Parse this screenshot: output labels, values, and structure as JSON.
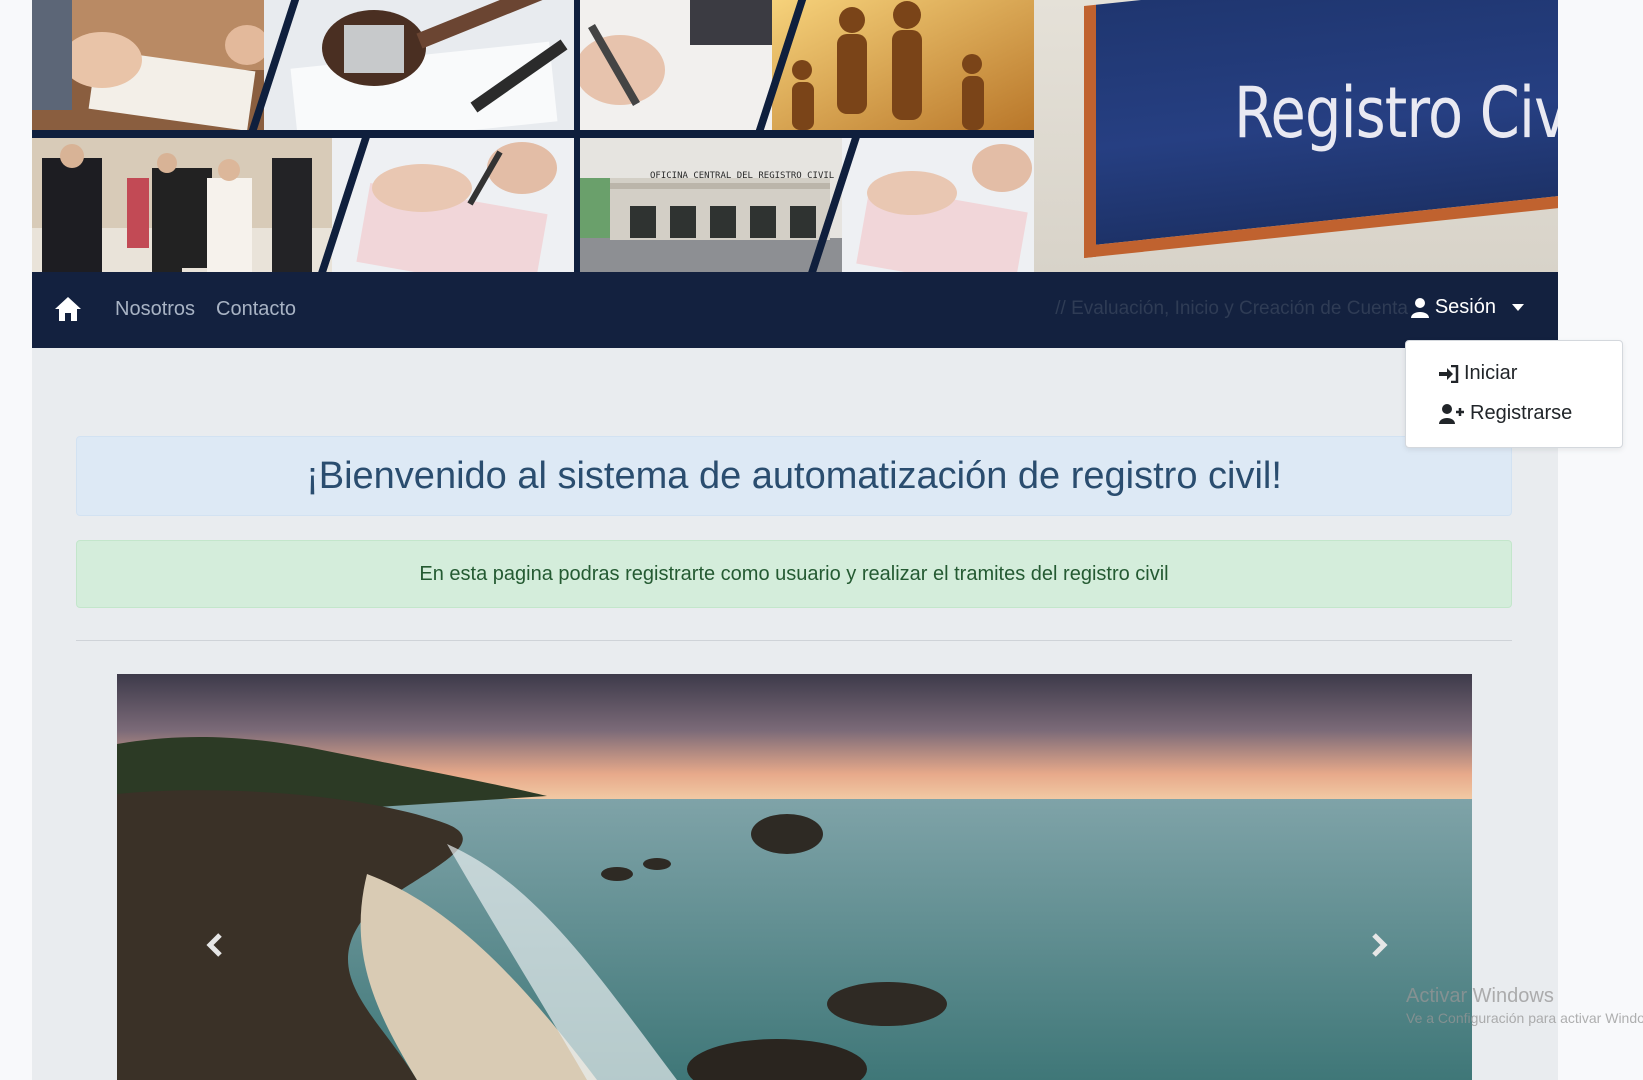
{
  "banner": {
    "sign_text": "Registro Civil",
    "building_sign": "OFICINA CENTRAL DEL REGISTRO CIVIL"
  },
  "navbar": {
    "home_icon": "home-icon",
    "links": [
      {
        "label": "Nosotros"
      },
      {
        "label": "Contacto"
      }
    ],
    "hidden_text": "// Evaluación, Inicio y Creación de Cuenta",
    "session": {
      "label": "Sesión",
      "icon": "user-icon"
    }
  },
  "dropdown": {
    "items": [
      {
        "label": "Iniciar",
        "icon": "sign-in-icon"
      },
      {
        "label": "Registrarse",
        "icon": "user-plus-icon"
      }
    ]
  },
  "main": {
    "welcome": "¡Bienvenido al sistema de automatización de registro civil!",
    "info": "En esta pagina podras registrarte como usuario y realizar el tramites del registro civil"
  },
  "carousel": {
    "prev_icon": "chevron-left-icon",
    "next_icon": "chevron-right-icon"
  },
  "watermark": {
    "title": "Activar Windows",
    "subtitle": "Ve a Configuración para activar Windows."
  },
  "colors": {
    "navbar": "#13213f",
    "welcome_bg": "#dde9f5",
    "info_bg": "#d4eddb",
    "sign_blue": "#263f82"
  }
}
